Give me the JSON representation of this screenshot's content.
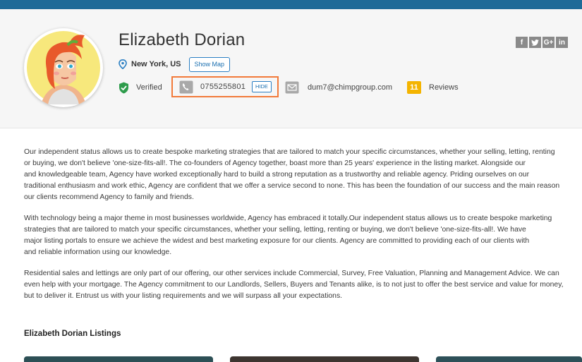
{
  "profile": {
    "name": "Elizabeth Dorian",
    "location": "New York, US",
    "show_map_label": "Show Map",
    "verified_label": "Verified",
    "phone": "0755255801",
    "hide_label": "HIDE",
    "email": "dum7@chimpgroup.com",
    "reviews_count": "11",
    "reviews_label": "Reviews"
  },
  "social": [
    {
      "icon": "facebook-icon",
      "glyph": "f"
    },
    {
      "icon": "twitter-icon",
      "glyph": "t"
    },
    {
      "icon": "google-plus-icon",
      "glyph": "G+"
    },
    {
      "icon": "linkedin-icon",
      "glyph": "in"
    }
  ],
  "bio": {
    "lines": [
      "Our independent status allows us to create bespoke marketing strategies that are tailored to match your specific circumstances, whether your selling, letting, renting",
      "or buying, we don't believe 'one-size-fits-all!. The co-founders of Agency together, boast more than 25 years' experience in the listing market. Alongside our",
      "and knowledgeable team, Agency have worked exceptionally hard to build a strong reputation as a trustworthy and reliable agency. Priding ourselves on our",
      "traditional enthusiasm and work ethic, Agency are confident that we offer a service second to none. This has been the foundation of our success and the main reason",
      "our clients recommend Agency to family and friends.",
      "With technology being a major theme in most businesses worldwide, Agency has embraced it totally.Our independent status allows us to create bespoke marketing",
      "strategies that are tailored to match your specific circumstances, whether your selling, letting, renting or buying, we don't believe 'one-size-fits-all!. We have",
      "major listing portals to ensure we achieve the widest and best marketing exposure for our clients. Agency are committed to providing each of our clients with",
      "and reliable information using our knowledge.",
      "Residential sales and lettings are only part of our offering, our other services include Commercial, Survey, Free Valuation, Planning and Management Advice. We can",
      "even help with your mortgage. The Agency commitment to our Landlords, Sellers, Buyers and Tenants alike, is to not just to offer the best service and value for money,",
      "but to deliver it. Entrust us with your listing requirements and we will surpass all your expectations."
    ]
  },
  "listings": {
    "title": "Elizabeth Dorian Listings"
  },
  "colors": {
    "topbar": "#1e6a98",
    "accent": "#2b7fc3",
    "highlight": "#f27a3a",
    "verified": "#2e9c4c",
    "badge": "#f4b400"
  }
}
